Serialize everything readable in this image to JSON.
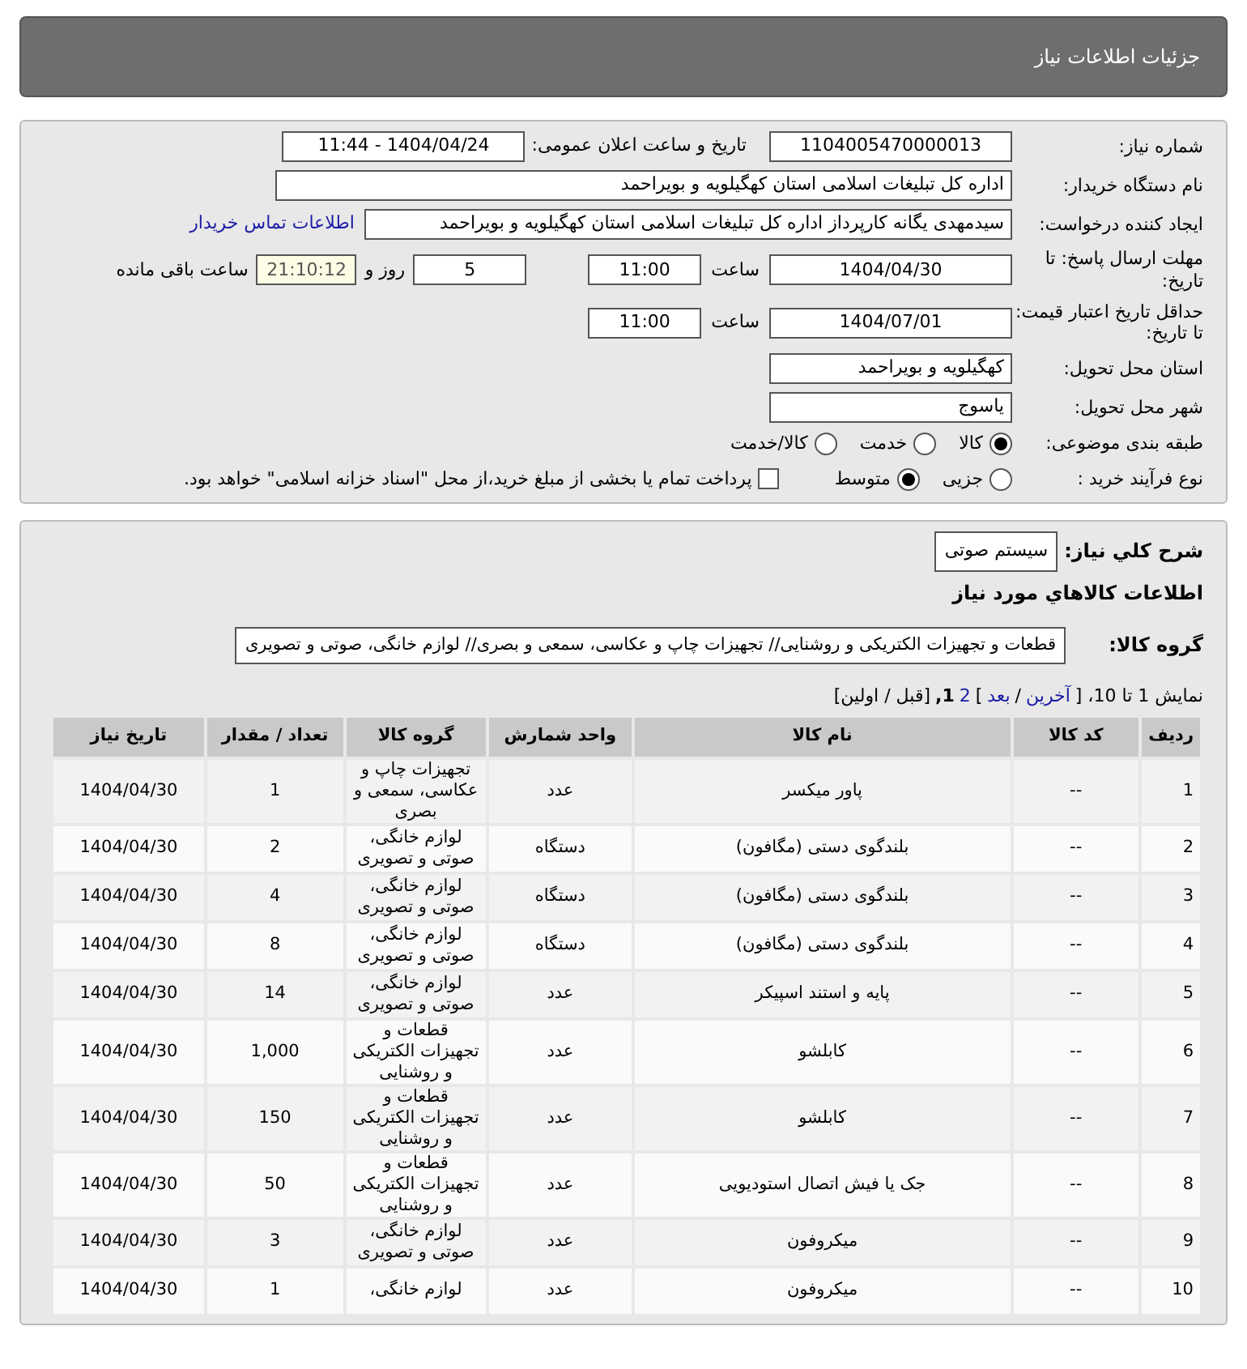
{
  "header": {
    "title": "جزئیات اطلاعات نیاز"
  },
  "form": {
    "need_number": {
      "label": "شماره نیاز:",
      "value": "1104005470000013"
    },
    "announce": {
      "label": "تاریخ و ساعت اعلان عمومی:",
      "value": "1404/04/24 - 11:44"
    },
    "buyer_org": {
      "label": "نام دستگاه خریدار:",
      "value": "اداره کل تبلیغات اسلامی استان کهگیلویه و بویراحمد"
    },
    "creator": {
      "label": "ایجاد کننده درخواست:",
      "value": "سیدمهدی یگانه کارپرداز اداره کل تبلیغات اسلامی استان کهگیلویه و بویراحمد",
      "link": "اطلاعات تماس خریدار"
    },
    "deadline": {
      "label": "مهلت ارسال پاسخ: تا تاریخ:",
      "date": "1404/04/30",
      "time_label": "ساعت",
      "time": "11:00",
      "days": "5",
      "days_suffix": "روز و",
      "remaining": "21:10:12",
      "remaining_suffix": "ساعت باقی مانده"
    },
    "validity": {
      "label": "حداقل تاریخ اعتبار قیمت: تا تاریخ:",
      "date": "1404/07/01",
      "time_label": "ساعت",
      "time": "11:00"
    },
    "province": {
      "label": "استان محل تحویل:",
      "value": "کهگیلویه و بویراحمد"
    },
    "city": {
      "label": "شهر محل تحویل:",
      "value": "یاسوج"
    },
    "category": {
      "label": "طبقه بندی موضوعی:",
      "options": [
        {
          "label": "کالا",
          "selected": true
        },
        {
          "label": "خدمت",
          "selected": false
        },
        {
          "label": "کالا/خدمت",
          "selected": false
        }
      ]
    },
    "process": {
      "label": "نوع فرآیند خرید :",
      "options": [
        {
          "label": "جزیی",
          "selected": false
        },
        {
          "label": "متوسط",
          "selected": true
        }
      ],
      "payment": {
        "checked": false,
        "text": "پرداخت تمام یا بخشی از مبلغ خرید،از محل \"اسناد خزانه اسلامی\" خواهد بود."
      }
    }
  },
  "summary": {
    "label": "شرح کلي نياز:",
    "value": "سیستم صوتی"
  },
  "goods_title": "اطلاعات کالاهاي مورد نياز",
  "goods_group": {
    "label": "گروه کالا:",
    "value": "قطعات و تجهیزات الکتریکی و روشنایی// تجهیزات چاپ و عکاسی، سمعی و بصری// لوازم خانگی، صوتی و تصویری"
  },
  "pagination": [
    {
      "kind": "text",
      "text": "نمایش 1 تا 10، ["
    },
    {
      "kind": "link",
      "text": "آخرین"
    },
    {
      "kind": "text",
      "text": "/"
    },
    {
      "kind": "link",
      "text": "بعد"
    },
    {
      "kind": "text",
      "text": "]"
    },
    {
      "kind": "link",
      "text": "2"
    },
    {
      "kind": "current",
      "text": "1,"
    },
    {
      "kind": "text",
      "text": "[قبل / اولین]"
    }
  ],
  "table": {
    "columns": [
      "ردیف",
      "کد کالا",
      "نام کالا",
      "واحد شمارش",
      "گروه کالا",
      "تعداد / مقدار",
      "تاریخ نیاز"
    ],
    "rows": [
      [
        "1",
        "--",
        "پاور میکسر",
        "عدد",
        "تجهیزات چاپ و عکاسی، سمعی و بصری",
        "1",
        "1404/04/30"
      ],
      [
        "2",
        "--",
        "بلندگوی دستی (مگافون)",
        "دستگاه",
        "لوازم خانگی، صوتی و تصویری",
        "2",
        "1404/04/30"
      ],
      [
        "3",
        "--",
        "بلندگوی دستی (مگافون)",
        "دستگاه",
        "لوازم خانگی، صوتی و تصویری",
        "4",
        "1404/04/30"
      ],
      [
        "4",
        "--",
        "بلندگوی دستی (مگافون)",
        "دستگاه",
        "لوازم خانگی، صوتی و تصویری",
        "8",
        "1404/04/30"
      ],
      [
        "5",
        "--",
        "پایه و استند اسپیکر",
        "عدد",
        "لوازم خانگی، صوتی و تصویری",
        "14",
        "1404/04/30"
      ],
      [
        "6",
        "--",
        "کابلشو",
        "عدد",
        "قطعات و تجهیزات الکتریکی و روشنایی",
        "1,000",
        "1404/04/30"
      ],
      [
        "7",
        "--",
        "کابلشو",
        "عدد",
        "قطعات و تجهیزات الکتریکی و روشنایی",
        "150",
        "1404/04/30"
      ],
      [
        "8",
        "--",
        "جک یا فیش اتصال استودیویی",
        "عدد",
        "قطعات و تجهیزات الکتریکی و روشنایی",
        "50",
        "1404/04/30"
      ],
      [
        "9",
        "--",
        "میکروفون",
        "عدد",
        "لوازم خانگی، صوتی و تصویری",
        "3",
        "1404/04/30"
      ],
      [
        "10",
        "--",
        "میکروفون",
        "عدد",
        "لوازم خانگی،",
        "1",
        "1404/04/30"
      ]
    ]
  }
}
